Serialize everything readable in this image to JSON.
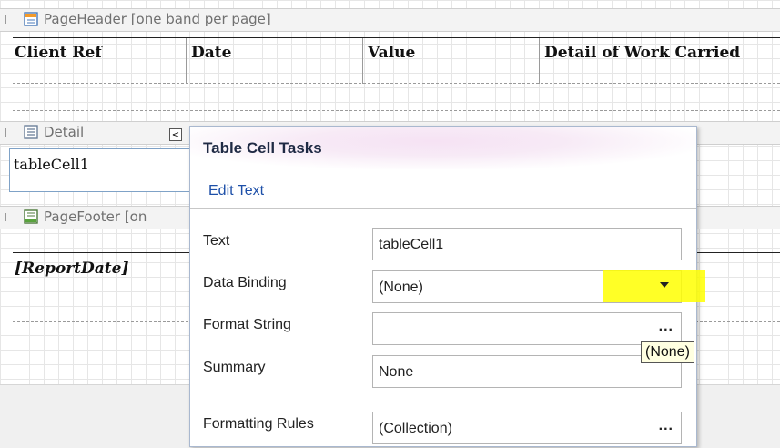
{
  "page_header": {
    "caption": "PageHeader [one band per page]"
  },
  "header_table": {
    "columns": [
      "Client Ref",
      "Date",
      "Value",
      "Detail of Work Carried"
    ]
  },
  "detail_band": {
    "caption": "Detail",
    "cell_text": "tableCell1",
    "collapse_glyph": "<"
  },
  "page_footer": {
    "caption": "PageFooter [on",
    "report_date": "[ReportDate]"
  },
  "tasks_panel": {
    "title": "Table Cell Tasks",
    "edit_text_link": "Edit Text",
    "properties": [
      {
        "label": "Text",
        "value": "tableCell1",
        "action": ""
      },
      {
        "label": "Data Binding",
        "value": "(None)",
        "action": "dropdown"
      },
      {
        "label": "Format String",
        "value": "",
        "action": "..."
      },
      {
        "label": "Summary",
        "value": "None",
        "action": ""
      },
      {
        "label": "Formatting Rules",
        "value": "(Collection)",
        "action": "..."
      }
    ],
    "tooltip": "(None)"
  },
  "colors": {
    "highlight": "#ffff00",
    "link": "#1d4fa8",
    "band_bg": "#f3f3f3"
  },
  "icons": [
    "page-header-icon",
    "detail-icon",
    "page-footer-icon",
    "collapse-icon",
    "dropdown-arrow-icon",
    "ellipsis-icon"
  ]
}
